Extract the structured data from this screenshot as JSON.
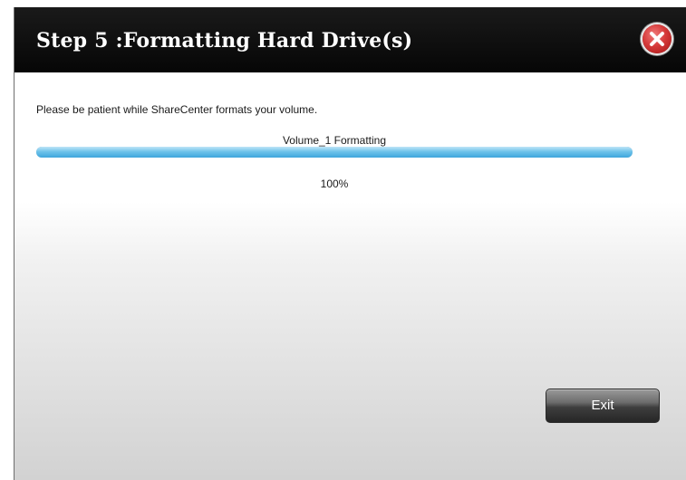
{
  "dialog": {
    "title": "Step 5 :Formatting Hard Drive(s)",
    "message": "Please be patient while ShareCenter formats your volume.",
    "progress": {
      "label": "Volume_1 Formatting",
      "percent_text": "100%",
      "value_percent": 100
    },
    "exit_label": "Exit",
    "close_icon": "close-x-icon"
  },
  "colors": {
    "titlebar": "#0b0b0b",
    "progress_fill": "#4fb3e3",
    "close_button": "#d63a3a",
    "exit_button": "#3e3e3e"
  }
}
